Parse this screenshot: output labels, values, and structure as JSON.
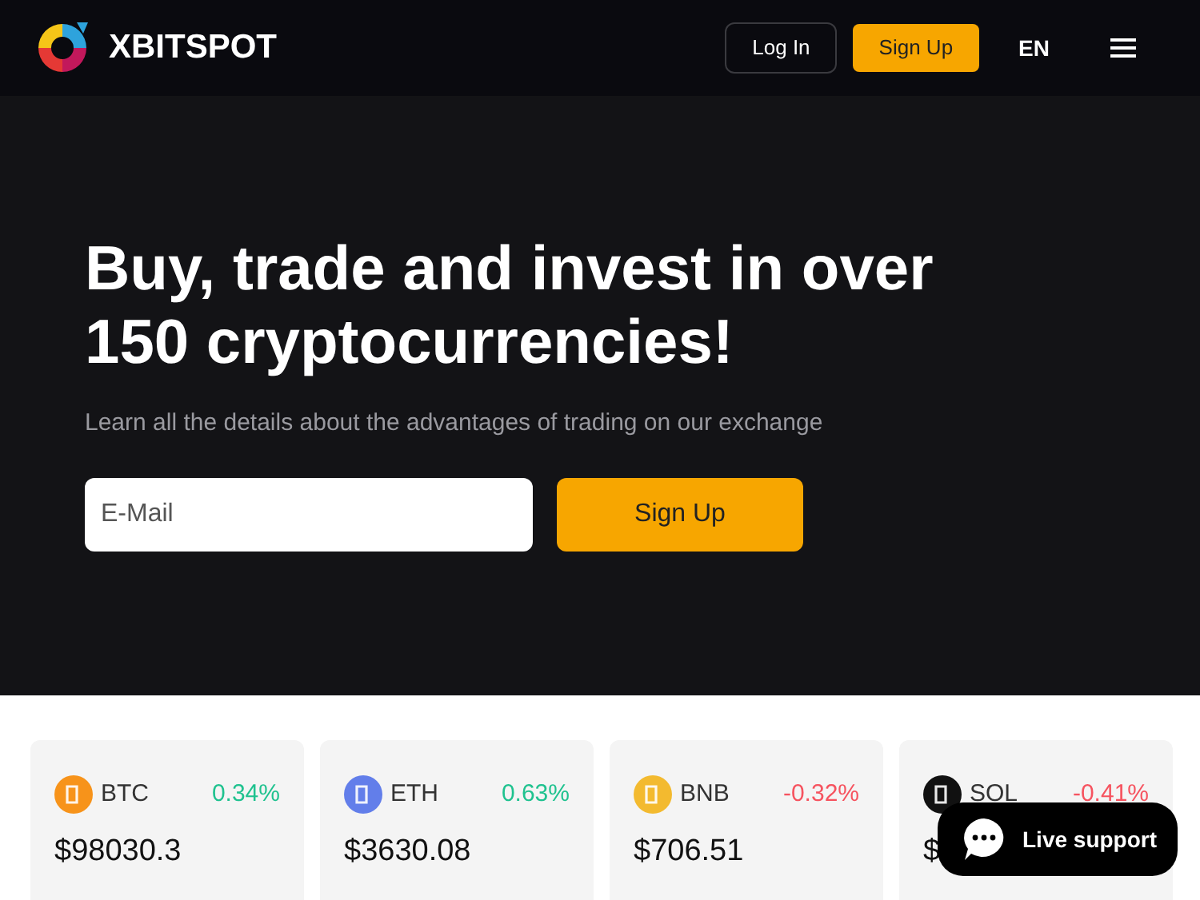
{
  "header": {
    "brand": "XBITSPOT",
    "login": "Log In",
    "signup": "Sign Up",
    "language": "EN"
  },
  "hero": {
    "title": "Buy, trade and invest in over 150 cryptocurrencies!",
    "subtitle": "Learn all the details about the advantages of trading on our exchange",
    "email": {
      "placeholder": "E-Mail"
    },
    "button": "Sign Up"
  },
  "tickers": [
    {
      "symbol": "BTC",
      "change": {
        "text": "0.34%",
        "color": "#1fc28f"
      },
      "price": "$98030.3",
      "color": "#f7931a"
    },
    {
      "symbol": "ETH",
      "change": {
        "text": "0.63%",
        "color": "#1fc28f"
      },
      "price": "$3630.08",
      "color": "#627eea"
    },
    {
      "symbol": "BNB",
      "change": {
        "text": "-0.32%",
        "color": "#f6535f"
      },
      "price": "$706.51",
      "color": "#f3ba2f"
    },
    {
      "symbol": "SOL",
      "change": {
        "text": "-0.41%",
        "color": "#f6535f"
      },
      "price": "$",
      "color": "#111111"
    }
  ],
  "live_support": "Live support"
}
